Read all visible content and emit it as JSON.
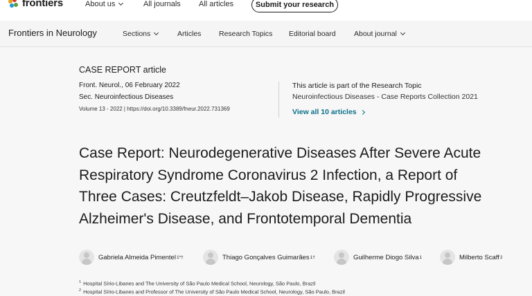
{
  "topbar": {
    "logo_text": "frontiers",
    "nav": [
      {
        "label": "About us",
        "has_dropdown": true
      },
      {
        "label": "All journals",
        "has_dropdown": false
      },
      {
        "label": "All articles",
        "has_dropdown": false
      }
    ],
    "submit_label": "Submit your research"
  },
  "journal_bar": {
    "name": "Frontiers in Neurology",
    "nav": [
      {
        "label": "Sections",
        "has_dropdown": true
      },
      {
        "label": "Articles",
        "has_dropdown": false
      },
      {
        "label": "Research Topics",
        "has_dropdown": false
      },
      {
        "label": "Editorial board",
        "has_dropdown": false
      },
      {
        "label": "About journal",
        "has_dropdown": true
      }
    ]
  },
  "article": {
    "type": "CASE REPORT article",
    "citation": "Front. Neurol., 06 February 2022",
    "section": "Sec. Neuroinfectious Diseases",
    "volume_doi": "Volume 13 - 2022 | https://doi.org/10.3389/fneur.2022.731369",
    "research_topic": {
      "heading": "This article is part of the Research Topic",
      "name": "Neuroinfectious Diseases - Case Reports Collection 2021",
      "view_all": "View all 10 articles"
    },
    "title_lines": [
      "Case Report: Neurodegenerative Diseases After Severe Acute",
      "Respiratory Syndrome Coronavirus 2 Infection, a Report of",
      "Three Cases: Creutzfeldt–Jakob Disease, Rapidly Progressive",
      "Alzheimer's Disease, and Frontotemporal Dementia"
    ],
    "authors": [
      {
        "name": "Gabriela Almeida Pimentel",
        "sup": "1*†"
      },
      {
        "name": "Thiago Gonçalves Guimarães",
        "sup": "1†"
      },
      {
        "name": "Guilherme Diogo Silva",
        "sup": "1"
      },
      {
        "name": "Milberto Scaff",
        "sup": "2"
      }
    ],
    "affiliations": [
      {
        "num": "1",
        "text": "Hospital Sírio-Libanes and The University of São Paulo Medical School, Neurology, São Paulo, Brazil"
      },
      {
        "num": "2",
        "text": "Hospital Sírio-Libanes and Professor of The University of São Paulo Medical School, Neurology, São Paulo, Brazil"
      }
    ]
  },
  "colors": {
    "link": "#0a6e8a",
    "logo_dots": [
      "#e8a317",
      "#d6322c",
      "#1f9ad6",
      "#5a9e3a"
    ]
  },
  "icons": [
    "frontiers-logo-icon",
    "chevron-down-icon",
    "chevron-right-icon",
    "avatar-placeholder-icon"
  ]
}
